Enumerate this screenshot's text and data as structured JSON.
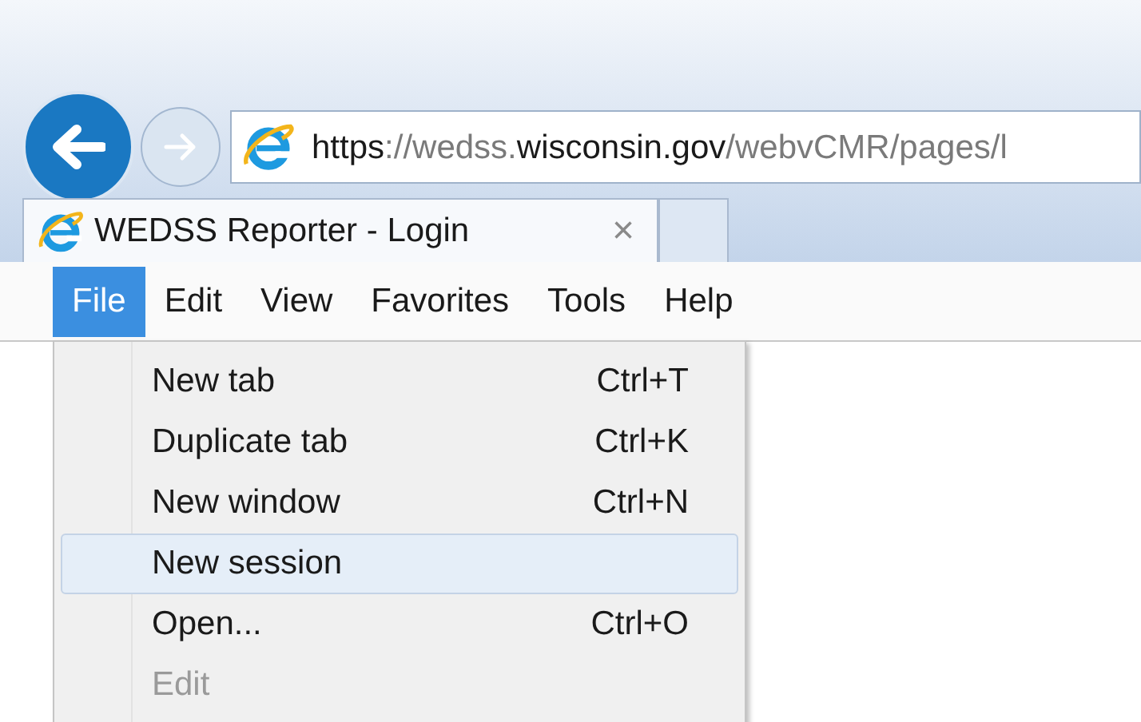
{
  "navigation": {
    "back": {
      "disabled": false
    },
    "forward": {
      "disabled": true
    }
  },
  "address_bar": {
    "segments": [
      {
        "text": "https",
        "emphasis": true
      },
      {
        "text": "://wedss.",
        "emphasis": false
      },
      {
        "text": "wisconsin.gov",
        "emphasis": true
      },
      {
        "text": "/webvCMR/pages/l",
        "emphasis": false
      }
    ]
  },
  "tabs": [
    {
      "title": "WEDSS Reporter - Login",
      "close": "×",
      "selected": true
    }
  ],
  "menu_bar": [
    {
      "label": "File",
      "selected": true
    },
    {
      "label": "Edit",
      "selected": false
    },
    {
      "label": "View",
      "selected": false
    },
    {
      "label": "Favorites",
      "selected": false
    },
    {
      "label": "Tools",
      "selected": false
    },
    {
      "label": "Help",
      "selected": false
    }
  ],
  "file_menu": [
    {
      "label": "New tab",
      "shortcut": "Ctrl+T",
      "selected": false,
      "disabled": false
    },
    {
      "label": "Duplicate tab",
      "shortcut": "Ctrl+K",
      "selected": false,
      "disabled": false
    },
    {
      "label": "New window",
      "shortcut": "Ctrl+N",
      "selected": false,
      "disabled": false
    },
    {
      "label": "New session",
      "selected": true,
      "disabled": false
    },
    {
      "label": "Open...",
      "shortcut": "Ctrl+O",
      "selected": false,
      "disabled": false
    },
    {
      "label": "Edit",
      "selected": false,
      "disabled": true
    }
  ]
}
